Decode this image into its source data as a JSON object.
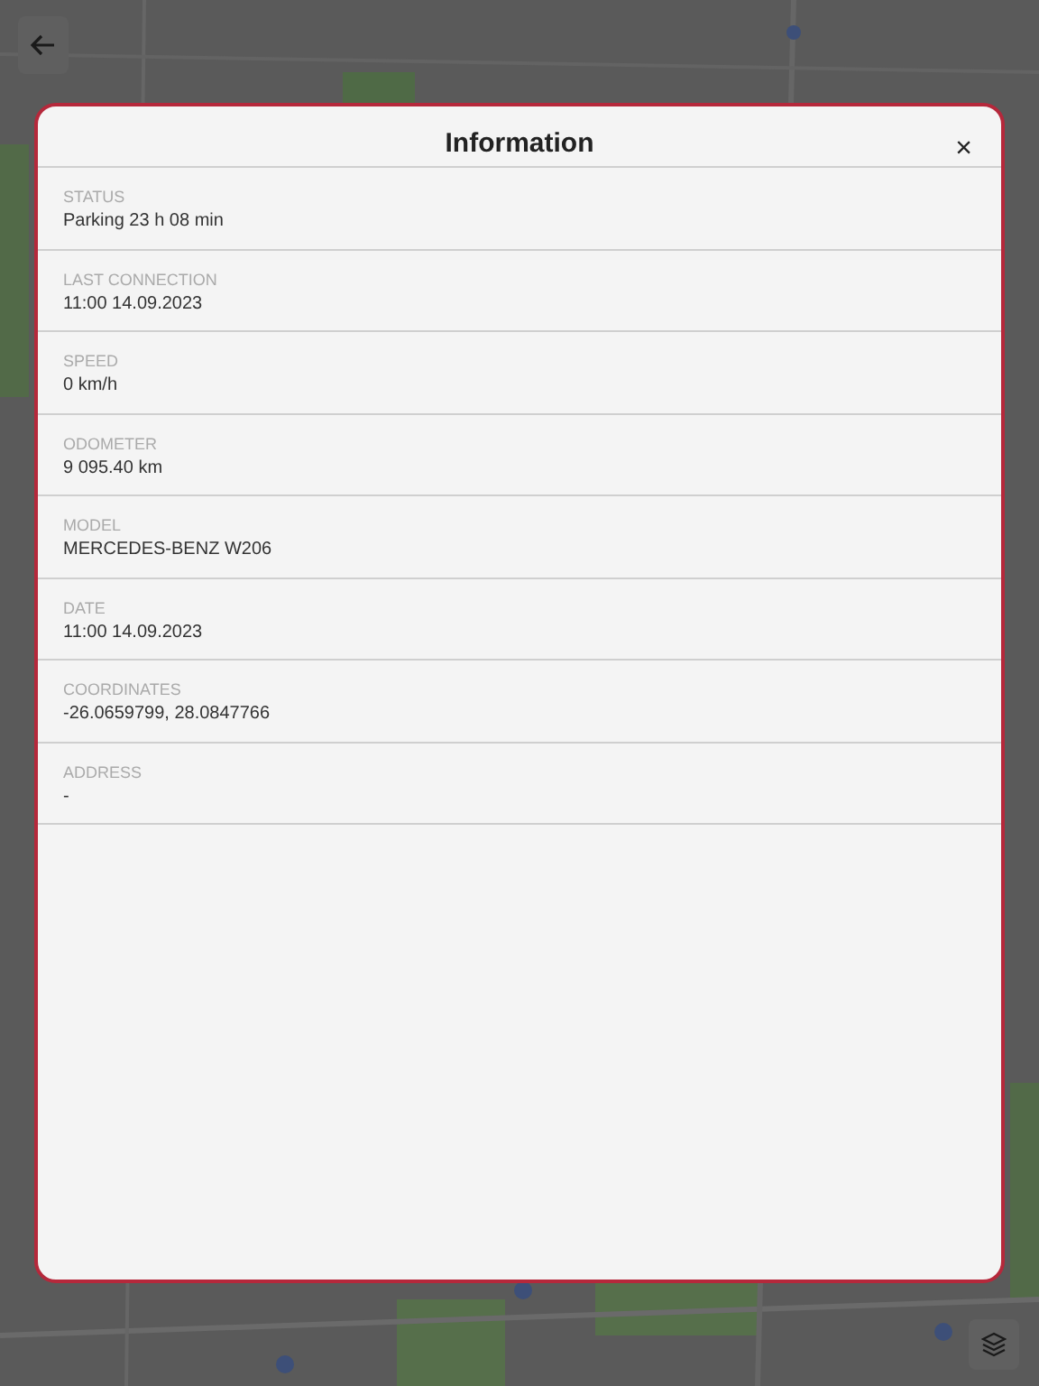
{
  "dialog": {
    "title": "Information",
    "close": "×",
    "fields": [
      {
        "label": "STATUS",
        "value": "Parking 23 h 08 min"
      },
      {
        "label": "LAST CONNECTION",
        "value": "11:00 14.09.2023"
      },
      {
        "label": "SPEED",
        "value": "0 km/h"
      },
      {
        "label": "ODOMETER",
        "value": "9 095.40 km"
      },
      {
        "label": "MODEL",
        "value": "MERCEDES-BENZ W206"
      },
      {
        "label": "DATE",
        "value": "11:00 14.09.2023"
      },
      {
        "label": "COORDINATES",
        "value": "-26.0659799, 28.0847766"
      },
      {
        "label": "ADDRESS",
        "value": "-"
      }
    ]
  }
}
